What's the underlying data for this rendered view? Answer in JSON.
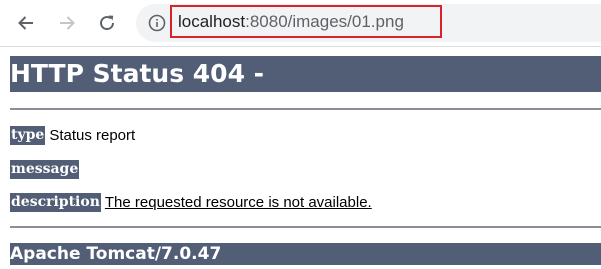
{
  "browser": {
    "back_icon": "arrow-left-icon",
    "forward_icon": "arrow-right-icon",
    "reload_icon": "reload-icon",
    "site_info_icon": "info-circle-icon",
    "url_host": "localhost",
    "url_rest": ":8080/images/01.png",
    "highlight_color": "#d9232b"
  },
  "page": {
    "title": "HTTP Status 404 -",
    "type_label": "type",
    "type_value": "Status report",
    "message_label": "message",
    "message_value": "",
    "description_label": "description",
    "description_value": "The requested resource is not available.",
    "footer": "Apache Tomcat/7.0.47",
    "accent_color": "#525d76"
  }
}
